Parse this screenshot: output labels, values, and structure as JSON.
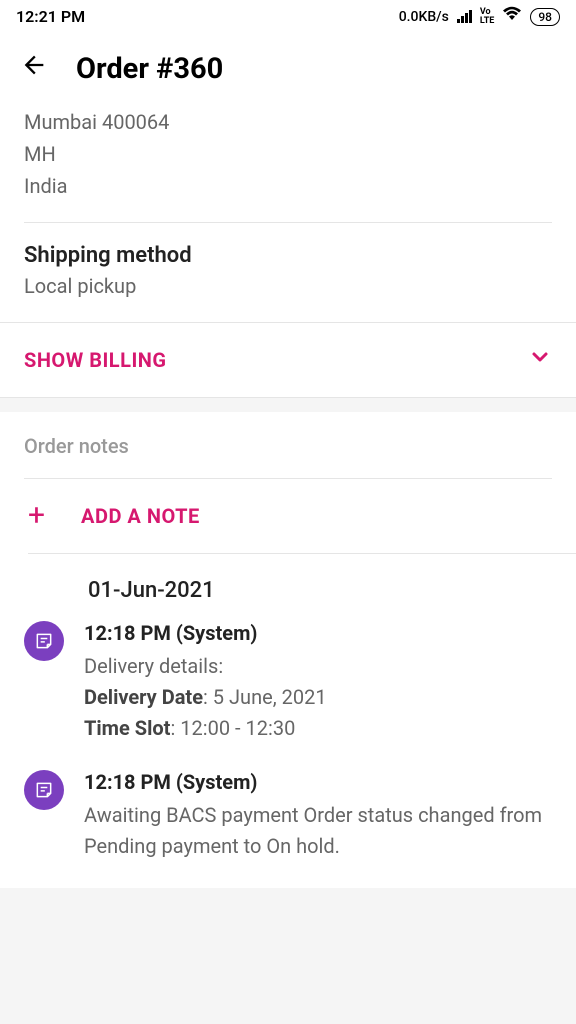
{
  "status": {
    "time": "12:21 PM",
    "speed": "0.0KB/s",
    "lte": "LTE",
    "volte": "Vo",
    "battery": "98"
  },
  "header": {
    "title": "Order #360"
  },
  "address": {
    "line1": "Mumbai 400064",
    "line2": "MH",
    "line3": "India"
  },
  "shipping": {
    "title": "Shipping method",
    "value": "Local pickup"
  },
  "billing": {
    "toggle_label": "SHOW BILLING"
  },
  "notes": {
    "section_label": "Order notes",
    "add_label": "ADD A NOTE",
    "date": "01-Jun-2021",
    "items": [
      {
        "time_author": "12:18 PM (System)",
        "intro": "Delivery details:",
        "line2_label": "Delivery Date",
        "line2_val": ": 5 June, 2021",
        "line3_label": "Time Slot",
        "line3_val": ": 12:00 - 12:30"
      },
      {
        "time_author": "12:18 PM (System)",
        "body": "Awaiting BACS payment Order status changed from Pending payment to On hold."
      }
    ]
  }
}
